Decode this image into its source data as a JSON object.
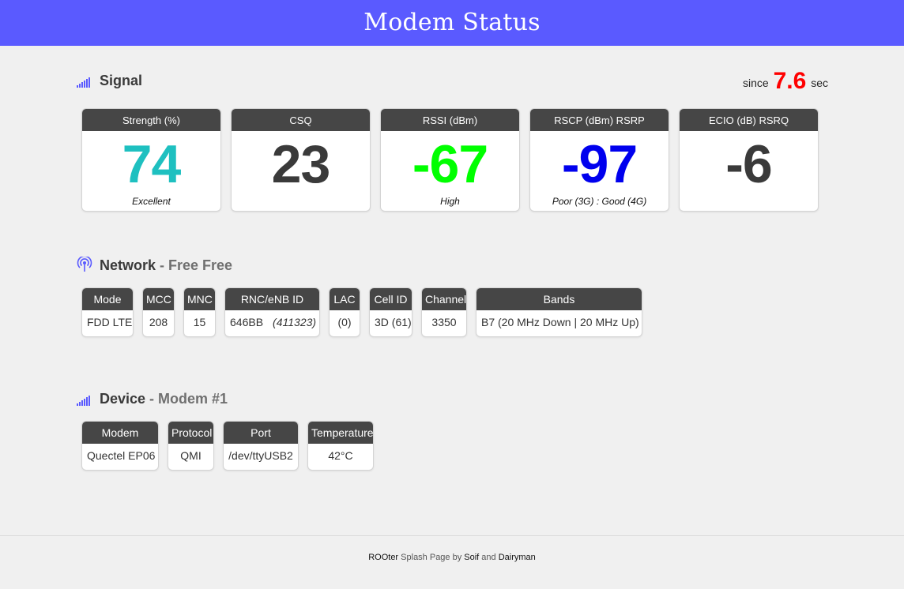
{
  "page": {
    "title": "Modem Status"
  },
  "signal": {
    "heading": "Signal",
    "since_prefix": "since",
    "since_value": "7.6",
    "since_suffix": "sec",
    "cards": [
      {
        "label": "Strength (%)",
        "value": "74",
        "note": "Excellent",
        "color": "#1ec0c0"
      },
      {
        "label": "CSQ",
        "value": "23",
        "note": "",
        "color": "#3a3a3a"
      },
      {
        "label": "RSSI (dBm)",
        "value": "-67",
        "note": "High",
        "color": "#00ff00"
      },
      {
        "label": "RSCP (dBm) RSRP",
        "value": "-97",
        "note": "Poor (3G) : Good (4G)",
        "color": "#0000ee"
      },
      {
        "label": "ECIO (dB) RSRQ",
        "value": "-6",
        "note": "",
        "color": "#3a3a3a"
      }
    ]
  },
  "network": {
    "heading": "Network",
    "separator": " - ",
    "operator": "Free Free",
    "fields": [
      {
        "label": "Mode",
        "value": "FDD LTE"
      },
      {
        "label": "MCC",
        "value": "208"
      },
      {
        "label": "MNC",
        "value": "15"
      },
      {
        "label": "RNC/eNB ID",
        "value": "646BB",
        "value2": "(411323)"
      },
      {
        "label": "LAC",
        "value": "(0)"
      },
      {
        "label": "Cell ID",
        "value": "3D (61)"
      },
      {
        "label": "Channel",
        "value": "3350"
      },
      {
        "label": "Bands",
        "value": "B7 (20 MHz Down | 20 MHz Up)"
      }
    ]
  },
  "device": {
    "heading": "Device",
    "separator": " - ",
    "name": "Modem #1",
    "fields": [
      {
        "label": "Modem",
        "value": "Quectel EP06"
      },
      {
        "label": "Protocol",
        "value": "QMI"
      },
      {
        "label": "Port",
        "value": "/dev/ttyUSB2"
      },
      {
        "label": "Temperature",
        "value": "42°C"
      }
    ]
  },
  "footer": {
    "part1": "ROOter",
    "part2": " Splash Page by ",
    "part3": "Soif",
    "part4": " and ",
    "part5": "Dairyman"
  },
  "icons": {
    "signal": "signal-bars-icon",
    "network": "antenna-icon",
    "device": "signal-bars-icon"
  },
  "colors": {
    "accent": "#5a5aff",
    "since_number": "#ff0000"
  }
}
